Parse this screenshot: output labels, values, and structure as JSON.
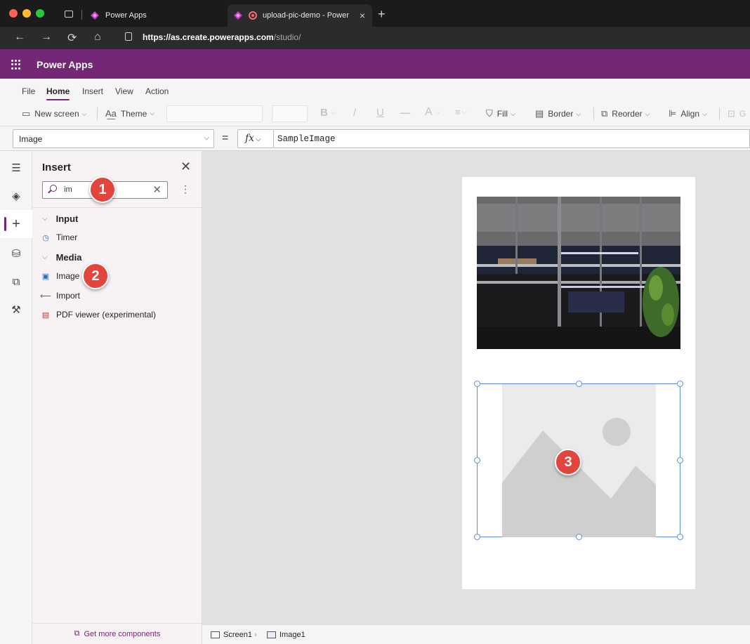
{
  "browser": {
    "tabs": [
      {
        "label": "Power Apps",
        "active": false
      },
      {
        "label": "upload-pic-demo - Power",
        "active": true
      }
    ],
    "url_domain": "https://as.create.powerapps.com",
    "url_path": "/studio/"
  },
  "app": {
    "title": "Power Apps",
    "brand_color": "#742774"
  },
  "menu": {
    "tabs": [
      {
        "label": "File",
        "active": false
      },
      {
        "label": "Home",
        "active": true
      },
      {
        "label": "Insert",
        "active": false
      },
      {
        "label": "View",
        "active": false
      },
      {
        "label": "Action",
        "active": false
      }
    ]
  },
  "toolbar": {
    "new_screen": "New screen",
    "theme": "Theme",
    "bold": "B",
    "italic": "/",
    "underline": "U",
    "strike": "−−",
    "font_size_label": "A",
    "fill": "Fill",
    "border": "Border",
    "reorder": "Reorder",
    "align": "Align",
    "group": "G"
  },
  "formula_bar": {
    "property": "Image",
    "equals": "=",
    "fx": "fx",
    "formula": "SampleImage"
  },
  "rail": {
    "items": [
      "menu-icon",
      "layers-icon",
      "insert-icon",
      "data-icon",
      "media-icon",
      "tools-icon"
    ],
    "active": "insert-icon"
  },
  "insert_panel": {
    "title": "Insert",
    "search_value": "im",
    "categories": [
      {
        "label": "Input",
        "items": [
          {
            "label": "Timer",
            "icon": "timer-icon"
          }
        ]
      },
      {
        "label": "Media",
        "items": [
          {
            "label": "Image",
            "icon": "image-icon"
          },
          {
            "label": "Import",
            "icon": "import-icon"
          },
          {
            "label": "PDF viewer (experimental)",
            "icon": "pdf-icon"
          }
        ]
      }
    ],
    "get_more": "Get more components"
  },
  "badges": [
    "1",
    "2",
    "3"
  ],
  "statusbar": {
    "screen": "Screen1",
    "control": "Image1"
  }
}
